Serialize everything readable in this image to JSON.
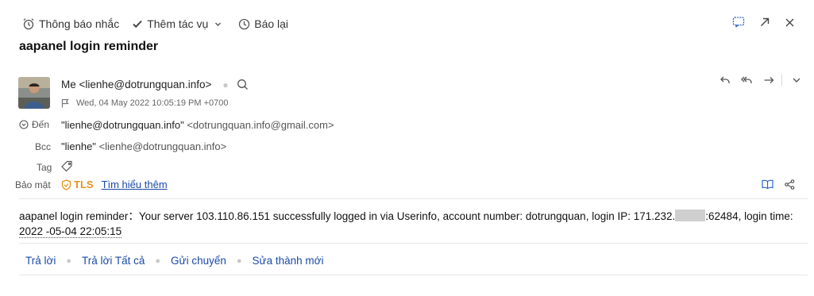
{
  "toolbar": {
    "reminder": "Thông báo nhắc",
    "add_task": "Thêm tác vụ",
    "snooze": "Báo lại"
  },
  "subject": "aapanel login reminder",
  "sender": {
    "display": "Me <lienhe@dotrungquan.info>",
    "date": "Wed, 04 May 2022 10:05:19 PM +0700"
  },
  "recipients": {
    "to_label": "Đến",
    "to_name": "\"lienhe@dotrungquan.info\"",
    "to_addr": "<dotrungquan.info@gmail.com>",
    "bcc_label": "Bcc",
    "bcc_name": "\"lienhe\"",
    "bcc_addr": "<lienhe@dotrungquan.info>",
    "tag_label": "Tag"
  },
  "security": {
    "label": "Bảo mật",
    "tls": "TLS",
    "learn_more": "Tìm hiểu thêm"
  },
  "body": {
    "part1": "aapanel login reminder：Your server 103.110.86.151 successfully logged in via Userinfo, account number: dotrungquan, login IP: 171.232.",
    "part2": ":62484, login time: ",
    "time": "2022 -05-04 22:05:15"
  },
  "reply_bar": {
    "reply": "Trả lời",
    "reply_all": "Trả lời Tất cả",
    "forward": "Gửi chuyển",
    "edit_new": "Sửa thành mới"
  },
  "colors": {
    "link": "#1a4aa8",
    "tls": "#e4941d"
  }
}
